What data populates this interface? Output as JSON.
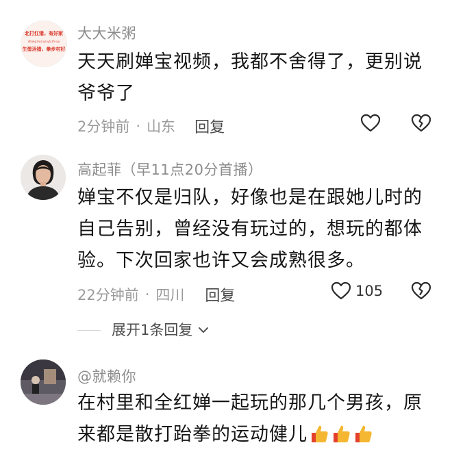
{
  "comments": [
    {
      "username": "大大米粥",
      "content_lines": [
        "天天刷婵宝视频，我都不舍得了，更别说",
        "爷爷了"
      ],
      "time": "2分钟前",
      "location": "山东",
      "reply_label": "回复",
      "like_count": "",
      "avatar_text": [
        "北打扛猎，有好家",
        "shang hua ya yá zhi yu",
        "生蛋活猎，拳步村好"
      ]
    },
    {
      "username": "高起菲（早11点20分首播）",
      "content_lines": [
        "婵宝不仅是归队，好像也是在跟她儿时的",
        "自己告别，曾经没有玩过的，想玩的都体",
        "验。下次回家也许又会成熟很多。"
      ],
      "time": "22分钟前",
      "location": "四川",
      "reply_label": "回复",
      "like_count": "105"
    },
    {
      "username": "@就赖你",
      "content_lines": [
        "在村里和全红婵一起玩的那几个男孩，原",
        "来都是散打跆拳的运动健儿"
      ]
    }
  ],
  "expand_replies_label": "展开1条回复",
  "icons": {
    "like": "heart-outline-icon",
    "dislike": "broken-heart-icon",
    "expand": "chevron-down-icon",
    "emoji": "thumbs-up-emoji"
  },
  "colors": {
    "meta_text": "#9a9a9a",
    "content_text": "#161616",
    "emoji_yellow": "#f5b731",
    "emoji_red": "#e4412c"
  }
}
